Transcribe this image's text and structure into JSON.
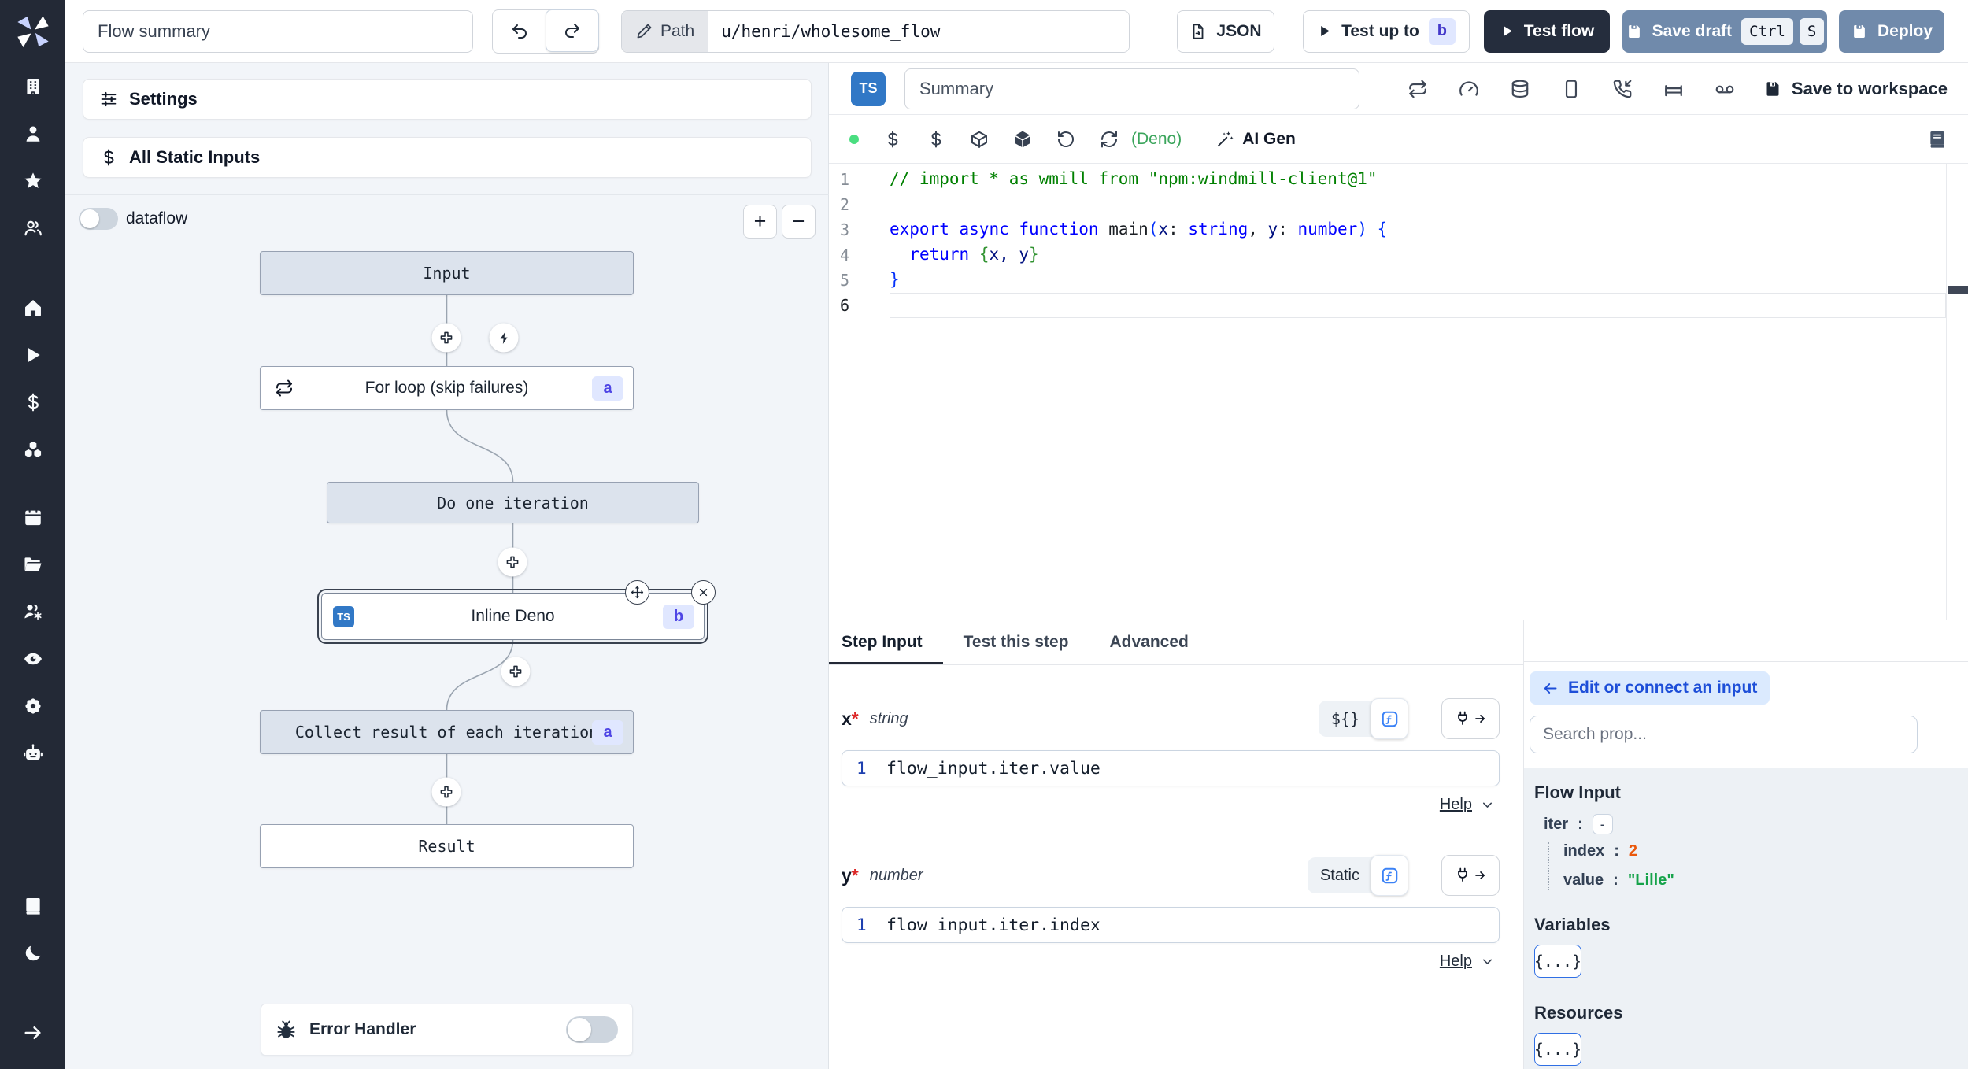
{
  "topbar": {
    "flow_summary_placeholder": "Flow summary",
    "path_label": "Path",
    "path_value": "u/henri/wholesome_flow",
    "json_label": "JSON",
    "test_up_to_label": "Test up to",
    "test_up_to_badge": "b",
    "test_flow_label": "Test flow",
    "save_draft_label": "Save draft",
    "kbd_ctrl": "Ctrl",
    "kbd_s": "S",
    "deploy_label": "Deploy"
  },
  "sidebar": {
    "sections": [
      [
        "building",
        "user",
        "star",
        "users"
      ],
      [
        "home",
        "play",
        "dollar",
        "boxes"
      ],
      [
        "calendar",
        "folder-open",
        "users-gear",
        "eye",
        "gear",
        "bot"
      ],
      [
        "book",
        "moon"
      ],
      [
        "arrow-right"
      ]
    ]
  },
  "flow_panel": {
    "settings_label": "Settings",
    "static_inputs_label": "All Static Inputs",
    "dataflow_label": "dataflow",
    "zoom_in": "+",
    "zoom_out": "−",
    "nodes": {
      "input": "Input",
      "forloop": "For loop (skip failures)",
      "forloop_badge": "a",
      "iteration": "Do one iteration",
      "inline": "Inline Deno",
      "inline_badge": "b",
      "inline_lang": "TS",
      "collect": "Collect result of each iteration",
      "collect_badge": "a",
      "result": "Result"
    },
    "error_handler_label": "Error Handler"
  },
  "editor": {
    "lang_badge": "TS",
    "summary_placeholder": "Summary",
    "header_icons": [
      "repeat",
      "gauge",
      "database",
      "tablet",
      "phone-incoming",
      "bed",
      "voicemail"
    ],
    "save_to_workspace_label": "Save to workspace",
    "status_dot_color": "#4ade80",
    "quick_icons": [
      "dollar",
      "dollar",
      "box",
      "box-filled",
      "rotate-ccw",
      "refresh-cw"
    ],
    "runtime_label": "(Deno)",
    "ai_gen_label": "AI Gen",
    "code": {
      "lines": [
        {
          "tokens": [
            {
              "t": "// import * as wmill from \"npm:windmill-client@1\"",
              "c": "c"
            }
          ]
        },
        {
          "tokens": []
        },
        {
          "tokens": [
            {
              "t": "export",
              "c": "k"
            },
            {
              "t": " "
            },
            {
              "t": "async",
              "c": "k"
            },
            {
              "t": " "
            },
            {
              "t": "function",
              "c": "k"
            },
            {
              "t": " main"
            },
            {
              "t": "(",
              "c": "b1"
            },
            {
              "t": "x",
              "c": "p"
            },
            {
              "t": ": "
            },
            {
              "t": "string",
              "c": "t"
            },
            {
              "t": ", "
            },
            {
              "t": "y",
              "c": "p"
            },
            {
              "t": ": "
            },
            {
              "t": "number",
              "c": "t"
            },
            {
              "t": ")",
              "c": "b1"
            },
            {
              "t": " "
            },
            {
              "t": "{",
              "c": "b1"
            }
          ]
        },
        {
          "tokens": [
            {
              "t": "  "
            },
            {
              "t": "return",
              "c": "k"
            },
            {
              "t": " "
            },
            {
              "t": "{",
              "c": "b2"
            },
            {
              "t": "x, y",
              "c": "p"
            },
            {
              "t": "}",
              "c": "b2"
            }
          ]
        },
        {
          "tokens": [
            {
              "t": "}",
              "c": "b1"
            }
          ]
        },
        {
          "tokens": [],
          "current": true
        }
      ]
    }
  },
  "step_panel": {
    "tabs": [
      "Step Input",
      "Test this step",
      "Advanced"
    ],
    "active_tab": "Step Input",
    "fields": [
      {
        "label": "x",
        "required": "*",
        "type": "string",
        "mode": "${}",
        "line": "1",
        "expr": "flow_input.iter.value",
        "help": "Help"
      },
      {
        "label": "y",
        "required": "*",
        "type": "number",
        "mode": "Static",
        "line": "1",
        "expr": "flow_input.iter.index",
        "help": "Help"
      }
    ]
  },
  "prop_panel": {
    "back_label": "Edit or connect an input",
    "search_placeholder": "Search prop...",
    "flow_input_title": "Flow Input",
    "tree": {
      "iter_key": "iter",
      "iter_toggle": "-",
      "index_key": "index",
      "index_value": "2",
      "value_key": "value",
      "value_value": "\"Lille\""
    },
    "variables_title": "Variables",
    "variables_button": "{...}",
    "resources_title": "Resources",
    "resources_button": "{...}"
  },
  "colors": {
    "ts_blue": "#3178c6",
    "steel_blue": "#708aab",
    "dark_navy": "#252d3d",
    "badge_bg": "#e0e7ff",
    "badge_text": "#4f46e5",
    "runtime_green": "#3ba55c",
    "index_orange": "#ea580c",
    "value_green": "#16a34a",
    "link_blue": "#1d4ed8"
  }
}
